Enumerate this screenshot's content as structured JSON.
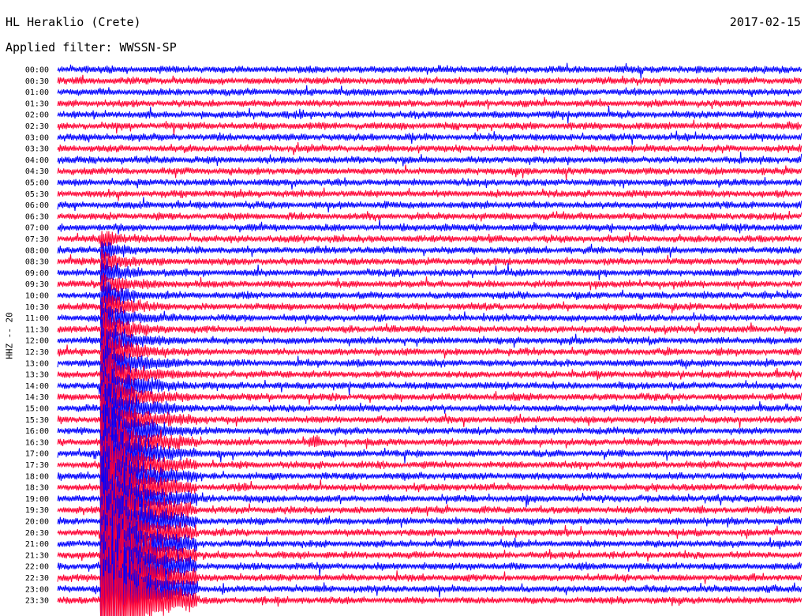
{
  "header": {
    "station": "HL Heraklio (Crete)",
    "date": "2017-02-15",
    "filter": "Applied filter: WWSSN-SP"
  },
  "chart_data": {
    "type": "line",
    "subtype": "helicorder",
    "channel_label": "HHZ -- 20",
    "row_labels": [
      "00:00",
      "00:30",
      "01:00",
      "01:30",
      "02:00",
      "02:30",
      "03:00",
      "03:30",
      "04:00",
      "04:30",
      "05:00",
      "05:30",
      "06:00",
      "06:30",
      "07:00",
      "07:30",
      "08:00",
      "08:30",
      "09:00",
      "09:30",
      "10:00",
      "10:30",
      "11:00",
      "11:30",
      "12:00",
      "12:30",
      "13:00",
      "13:30",
      "14:00",
      "14:30",
      "15:00",
      "15:30",
      "16:00",
      "16:30",
      "17:00",
      "17:30",
      "18:00",
      "18:30",
      "19:00",
      "19:30",
      "20:00",
      "20:30",
      "21:00",
      "21:30",
      "22:00",
      "22:30",
      "23:00",
      "23:30"
    ],
    "row_duration_minutes": 30,
    "trace_colors": [
      "#0000ff",
      "#ff0033"
    ],
    "events": [
      {
        "description": "large event",
        "start_minute_in_row": 1.8,
        "rows_affected_from": "07:30",
        "rows_affected_to": "23:30"
      },
      {
        "description": "local burst",
        "row": "16:30",
        "minute_in_row": 10.4
      }
    ],
    "grid": false,
    "legend": "none"
  }
}
